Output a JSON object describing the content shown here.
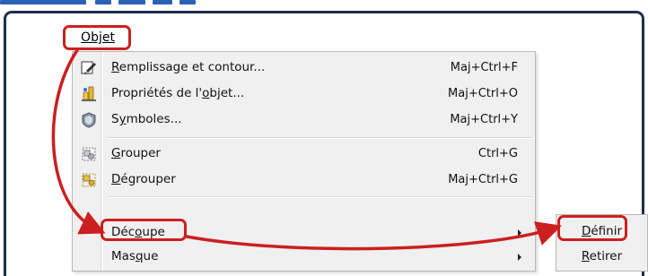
{
  "menubar": {
    "object_menu_label": "Objet"
  },
  "menu": {
    "items": [
      {
        "label": "Remplissage et contour...",
        "mnemonic": "R",
        "rest": "emplissage et contour...",
        "shortcut": "Maj+Ctrl+F",
        "icon": "fill-stroke-icon"
      },
      {
        "label": "Propriétés de l'objet...",
        "pre": "Propriétés de l'",
        "mnemonic": "o",
        "rest": "bjet...",
        "shortcut": "Maj+Ctrl+O",
        "icon": "object-properties-icon"
      },
      {
        "label": "Symboles...",
        "pre": "S",
        "mnemonic": "y",
        "rest": "mboles...",
        "shortcut": "Maj+Ctrl+Y",
        "icon": "symbols-icon"
      },
      {
        "label": "Grouper",
        "mnemonic": "G",
        "rest": "rouper",
        "shortcut": "Ctrl+G",
        "icon": "group-icon"
      },
      {
        "label": "Dégrouper",
        "mnemonic": "D",
        "rest": "égrouper",
        "shortcut": "Maj+Ctrl+G",
        "icon": "ungroup-icon"
      },
      {
        "label": "Découpe",
        "pre": "Déc",
        "mnemonic": "o",
        "rest": "upe",
        "submenu": true
      },
      {
        "label": "Masque",
        "pre": "Mas",
        "mnemonic": "q",
        "rest": "ue",
        "submenu": true
      }
    ]
  },
  "submenu": {
    "items": [
      {
        "label": "Définir",
        "mnemonic": "D",
        "rest": "éfinir"
      },
      {
        "label": "Retirer",
        "mnemonic": "R",
        "rest": "etirer"
      }
    ]
  },
  "colors": {
    "annotation": "#cc1f1f",
    "window_frame": "#1d2e4a",
    "menu_bg": "#f0f0f0"
  }
}
